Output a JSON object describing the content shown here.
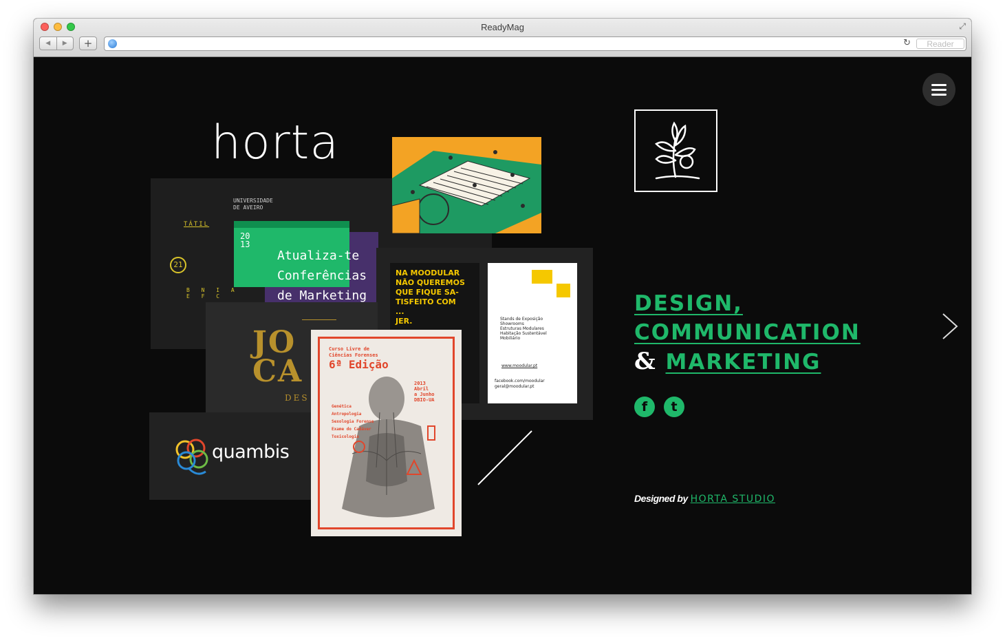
{
  "browser": {
    "title": "ReadyMag",
    "url": "",
    "reader_label": "Reader"
  },
  "collage": {
    "horta_wordmark": "horta",
    "tatil_panel": {
      "university": [
        "UNIVERSIDADE",
        "DE AVEIRO"
      ],
      "tatil": "TÁTIL",
      "badge": "21",
      "year": [
        "20",
        "13"
      ],
      "letters": [
        "B  N  I  A",
        "E  F  C"
      ],
      "headline": [
        "Atualiza-te",
        "Conferências",
        "de Marketing"
      ]
    },
    "moodular_poster": {
      "lines": [
        "NA MOODULAR",
        "NÃO QUEREMOS",
        "QUE FIQUE SA-",
        "TISFEITO COM",
        "...",
        "JER."
      ]
    },
    "moodular_card": {
      "services": [
        "Stands de Exposição",
        "Showrooms",
        "Estruturas Modulares",
        "Habitação Sustentável",
        "Mobiliário"
      ],
      "url": "www.moodular.pt",
      "contact": [
        "facebook.com/moodular",
        "geral@moodular.pt"
      ]
    },
    "joao_panel": {
      "lines": [
        "JO",
        "CA"
      ],
      "des": "DES"
    },
    "quambis_wordmark": "quambis",
    "forensics_poster": {
      "course": [
        "Curso Livre de",
        "Ciências Forenses"
      ],
      "edition": "6ª Edição",
      "dates": [
        "2013",
        "Abril",
        "a Junho",
        "DBIO-UA"
      ],
      "topics": [
        "Genética",
        "Antropologia",
        "Sexologia Forense",
        "Exame do Cadáver",
        "Toxicologia"
      ]
    }
  },
  "headline": {
    "line1": "DESIGN,",
    "line2": "COMMUNICATION",
    "amp": "&",
    "line3": "MARKETING"
  },
  "social": {
    "facebook": "f",
    "twitter": "t"
  },
  "credit": {
    "prefix": "Designed by",
    "studio": "HORTA STUDIO"
  },
  "colors": {
    "accent": "#1fb86a",
    "background": "#0b0b0b",
    "poster_red": "#e1462b",
    "moodular_yellow": "#f5c800"
  },
  "icons": [
    "menu-icon",
    "next-arrow-icon",
    "plant-logo-icon",
    "facebook-icon",
    "twitter-icon",
    "globe-icon",
    "reload-icon"
  ]
}
